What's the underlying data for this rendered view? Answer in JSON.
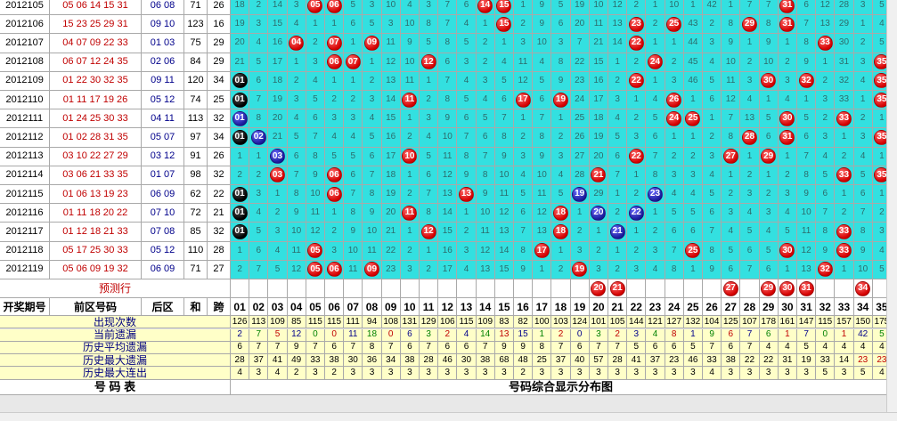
{
  "periods": [
    {
      "issue": "2012105",
      "front": "05 06 14 15 31",
      "back": "06 08",
      "sum": "71",
      "span": "26",
      "cells": [
        "18",
        "2",
        "14",
        "3",
        "R05",
        "R06",
        "5",
        "3",
        "10",
        "4",
        "3",
        "7",
        "6",
        "R14",
        "R15",
        "1",
        "9",
        "5",
        "19",
        "10",
        "12",
        "2",
        "1",
        "10",
        "1",
        "42",
        "1",
        "7",
        "7",
        "R31",
        "6",
        "12",
        "28",
        "3",
        "5"
      ]
    },
    {
      "issue": "2012106",
      "front": "15 23 25 29 31",
      "back": "09 10",
      "sum": "123",
      "span": "16",
      "cells": [
        "19",
        "3",
        "15",
        "4",
        "1",
        "1",
        "6",
        "5",
        "3",
        "10",
        "8",
        "7",
        "4",
        "1",
        "R15",
        "2",
        "9",
        "6",
        "20",
        "11",
        "13",
        "R23",
        "2",
        "R25",
        "43",
        "2",
        "8",
        "R29",
        "8",
        "R31",
        "7",
        "13",
        "29",
        "1",
        "4"
      ]
    },
    {
      "issue": "2012107",
      "front": "04 07 09 22 33",
      "back": "01 03",
      "sum": "75",
      "span": "29",
      "cells": [
        "20",
        "4",
        "16",
        "R04",
        "2",
        "R07",
        "1",
        "R09",
        "11",
        "9",
        "5",
        "8",
        "5",
        "2",
        "1",
        "3",
        "10",
        "3",
        "7",
        "21",
        "14",
        "R22",
        "1",
        "1",
        "44",
        "3",
        "9",
        "1",
        "9",
        "1",
        "8",
        "R33",
        "30",
        "2",
        "5"
      ]
    },
    {
      "issue": "2012108",
      "front": "06 07 12 24 35",
      "back": "02 06",
      "sum": "84",
      "span": "29",
      "cells": [
        "21",
        "5",
        "17",
        "1",
        "3",
        "R06",
        "R07",
        "1",
        "12",
        "10",
        "R12",
        "6",
        "3",
        "2",
        "4",
        "11",
        "4",
        "8",
        "22",
        "15",
        "1",
        "2",
        "R24",
        "2",
        "45",
        "4",
        "10",
        "2",
        "10",
        "2",
        "9",
        "1",
        "31",
        "3",
        "R35"
      ]
    },
    {
      "issue": "2012109",
      "front": "01 22 30 32 35",
      "back": "09 11",
      "sum": "120",
      "span": "34",
      "cells": [
        "K01",
        "6",
        "18",
        "2",
        "4",
        "1",
        "1",
        "2",
        "13",
        "11",
        "1",
        "7",
        "4",
        "3",
        "5",
        "12",
        "5",
        "9",
        "23",
        "16",
        "2",
        "R22",
        "1",
        "3",
        "46",
        "5",
        "11",
        "3",
        "R30",
        "3",
        "R32",
        "2",
        "32",
        "4",
        "R35"
      ]
    },
    {
      "issue": "2012110",
      "front": "01 11 17 19 26",
      "back": "05 12",
      "sum": "74",
      "span": "25",
      "cells": [
        "K01",
        "7",
        "19",
        "3",
        "5",
        "2",
        "2",
        "3",
        "14",
        "R11",
        "2",
        "8",
        "5",
        "4",
        "6",
        "R17",
        "6",
        "R19",
        "24",
        "17",
        "3",
        "1",
        "4",
        "R26",
        "1",
        "6",
        "12",
        "4",
        "1",
        "4",
        "1",
        "3",
        "33",
        "1",
        "R35"
      ]
    },
    {
      "issue": "2012111",
      "front": "01 24 25 30 33",
      "back": "04 11",
      "sum": "113",
      "span": "32",
      "cells": [
        "B01",
        "8",
        "20",
        "4",
        "6",
        "3",
        "3",
        "4",
        "15",
        "1",
        "3",
        "9",
        "6",
        "5",
        "7",
        "1",
        "7",
        "1",
        "25",
        "18",
        "4",
        "2",
        "5",
        "R24",
        "R25",
        "1",
        "7",
        "13",
        "5",
        "R30",
        "5",
        "2",
        "R33",
        "2",
        "1"
      ]
    },
    {
      "issue": "2012112",
      "front": "01 02 28 31 35",
      "back": "05 07",
      "sum": "97",
      "span": "34",
      "cells": [
        "K01",
        "B02",
        "21",
        "5",
        "7",
        "4",
        "4",
        "5",
        "16",
        "2",
        "4",
        "10",
        "7",
        "6",
        "8",
        "2",
        "8",
        "2",
        "26",
        "19",
        "5",
        "3",
        "6",
        "1",
        "1",
        "2",
        "8",
        "R28",
        "6",
        "R31",
        "6",
        "3",
        "1",
        "3",
        "R35"
      ]
    },
    {
      "issue": "2012113",
      "front": "03 10 22 27 29",
      "back": "03 12",
      "sum": "91",
      "span": "26",
      "cells": [
        "1",
        "1",
        "B03",
        "6",
        "8",
        "5",
        "5",
        "6",
        "17",
        "R10",
        "5",
        "11",
        "8",
        "7",
        "9",
        "3",
        "9",
        "3",
        "27",
        "20",
        "6",
        "R22",
        "7",
        "2",
        "2",
        "3",
        "R27",
        "1",
        "R29",
        "1",
        "7",
        "4",
        "2",
        "4",
        "1"
      ]
    },
    {
      "issue": "2012114",
      "front": "03 06 21 33 35",
      "back": "01 07",
      "sum": "98",
      "span": "32",
      "cells": [
        "2",
        "2",
        "R03",
        "7",
        "9",
        "R06",
        "6",
        "7",
        "18",
        "1",
        "6",
        "12",
        "9",
        "8",
        "10",
        "4",
        "10",
        "4",
        "28",
        "R21",
        "7",
        "1",
        "8",
        "3",
        "3",
        "4",
        "1",
        "2",
        "1",
        "2",
        "8",
        "5",
        "R33",
        "5",
        "R35"
      ]
    },
    {
      "issue": "2012115",
      "front": "01 06 13 19 23",
      "back": "06 09",
      "sum": "62",
      "span": "22",
      "cells": [
        "K01",
        "3",
        "1",
        "8",
        "10",
        "R06",
        "7",
        "8",
        "19",
        "2",
        "7",
        "13",
        "R13",
        "9",
        "11",
        "5",
        "11",
        "5",
        "B19",
        "29",
        "1",
        "2",
        "B23",
        "4",
        "4",
        "5",
        "2",
        "3",
        "2",
        "3",
        "9",
        "6",
        "1",
        "6",
        "1"
      ]
    },
    {
      "issue": "2012116",
      "front": "01 11 18 20 22",
      "back": "07 10",
      "sum": "72",
      "span": "21",
      "cells": [
        "K01",
        "4",
        "2",
        "9",
        "11",
        "1",
        "8",
        "9",
        "20",
        "R11",
        "8",
        "14",
        "1",
        "10",
        "12",
        "6",
        "12",
        "R18",
        "1",
        "B20",
        "2",
        "B22",
        "1",
        "5",
        "5",
        "6",
        "3",
        "4",
        "3",
        "4",
        "10",
        "7",
        "2",
        "7",
        "2"
      ]
    },
    {
      "issue": "2012117",
      "front": "01 12 18 21 33",
      "back": "07 08",
      "sum": "85",
      "span": "32",
      "cells": [
        "K01",
        "5",
        "3",
        "10",
        "12",
        "2",
        "9",
        "10",
        "21",
        "1",
        "R12",
        "15",
        "2",
        "11",
        "13",
        "7",
        "13",
        "R18",
        "2",
        "1",
        "B21",
        "1",
        "2",
        "6",
        "6",
        "7",
        "4",
        "5",
        "4",
        "5",
        "11",
        "8",
        "R33",
        "8",
        "3"
      ]
    },
    {
      "issue": "2012118",
      "front": "05 17 25 30 33",
      "back": "05 12",
      "sum": "110",
      "span": "28",
      "cells": [
        "1",
        "6",
        "4",
        "11",
        "R05",
        "3",
        "10",
        "11",
        "22",
        "2",
        "1",
        "16",
        "3",
        "12",
        "14",
        "8",
        "R17",
        "1",
        "3",
        "2",
        "1",
        "2",
        "3",
        "7",
        "R25",
        "8",
        "5",
        "6",
        "5",
        "R30",
        "12",
        "9",
        "R33",
        "9",
        "4"
      ]
    },
    {
      "issue": "2012119",
      "front": "05 06 09 19 32",
      "back": "06 09",
      "sum": "71",
      "span": "27",
      "cells": [
        "2",
        "7",
        "5",
        "12",
        "R05",
        "R06",
        "11",
        "R09",
        "23",
        "3",
        "2",
        "17",
        "4",
        "13",
        "15",
        "9",
        "1",
        "2",
        "R19",
        "3",
        "2",
        "3",
        "4",
        "8",
        "1",
        "9",
        "6",
        "7",
        "6",
        "1",
        "13",
        "R32",
        "1",
        "10",
        "5"
      ]
    }
  ],
  "prediction_label": "预测行",
  "prediction": [
    "",
    "",
    "",
    "",
    "",
    "",
    "",
    "",
    "",
    "",
    "",
    "",
    "",
    "",
    "",
    "",
    "",
    "",
    "",
    "R20",
    "R21",
    "",
    "",
    "",
    "",
    "",
    "R27",
    "",
    "R29",
    "R30",
    "R31",
    "",
    "",
    "R34",
    ""
  ],
  "header": {
    "issue": "开奖期号",
    "front": "前区号码",
    "back": "后区",
    "sum": "和",
    "span": "跨",
    "cols": [
      "01",
      "02",
      "03",
      "04",
      "05",
      "06",
      "07",
      "08",
      "09",
      "10",
      "11",
      "12",
      "13",
      "14",
      "15",
      "16",
      "17",
      "18",
      "19",
      "20",
      "21",
      "22",
      "23",
      "24",
      "25",
      "26",
      "27",
      "28",
      "29",
      "30",
      "31",
      "32",
      "33",
      "34",
      "35"
    ]
  },
  "stats": [
    {
      "label": "出现次数",
      "values": [
        "126",
        "113",
        "109",
        "85",
        "115",
        "115",
        "111",
        "94",
        "108",
        "131",
        "129",
        "106",
        "115",
        "109",
        "83",
        "82",
        "100",
        "103",
        "124",
        "101",
        "105",
        "144",
        "121",
        "127",
        "132",
        "104",
        "125",
        "107",
        "178",
        "161",
        "147",
        "115",
        "157",
        "150",
        "175"
      ]
    },
    {
      "label": "当前遗漏",
      "values": [
        "2",
        "7",
        "5",
        "12",
        "0",
        "0",
        "11",
        "18",
        "0",
        "6",
        "3",
        "2",
        "4",
        "14",
        "13",
        "15",
        "1",
        "2",
        "0",
        "3",
        "2",
        "3",
        "4",
        "8",
        "1",
        "9",
        "6",
        "7",
        "6",
        "1",
        "7",
        "0",
        "1",
        "42",
        "5"
      ]
    },
    {
      "label": "历史平均遗漏",
      "values": [
        "6",
        "7",
        "7",
        "9",
        "7",
        "6",
        "7",
        "8",
        "7",
        "6",
        "7",
        "6",
        "6",
        "7",
        "9",
        "9",
        "8",
        "7",
        "6",
        "7",
        "7",
        "5",
        "6",
        "6",
        "5",
        "7",
        "6",
        "7",
        "4",
        "4",
        "5",
        "4",
        "4",
        "4",
        "4"
      ]
    },
    {
      "label": "历史最大遗漏",
      "values": [
        "28",
        "37",
        "41",
        "49",
        "33",
        "38",
        "30",
        "36",
        "34",
        "38",
        "28",
        "46",
        "30",
        "38",
        "68",
        "48",
        "25",
        "37",
        "40",
        "57",
        "28",
        "41",
        "37",
        "23",
        "46",
        "33",
        "38",
        "22",
        "22",
        "31",
        "19",
        "33",
        "14",
        "23",
        "23"
      ]
    },
    {
      "label": "历史最大连出",
      "values": [
        "4",
        "3",
        "4",
        "2",
        "3",
        "2",
        "3",
        "3",
        "3",
        "3",
        "3",
        "3",
        "3",
        "3",
        "3",
        "2",
        "3",
        "3",
        "3",
        "3",
        "3",
        "3",
        "3",
        "3",
        "3",
        "4",
        "3",
        "3",
        "3",
        "3",
        "3",
        "5",
        "3",
        "5",
        "4"
      ]
    }
  ],
  "footer": {
    "left": "号  码  表",
    "right": "号码综合显示分布图"
  }
}
